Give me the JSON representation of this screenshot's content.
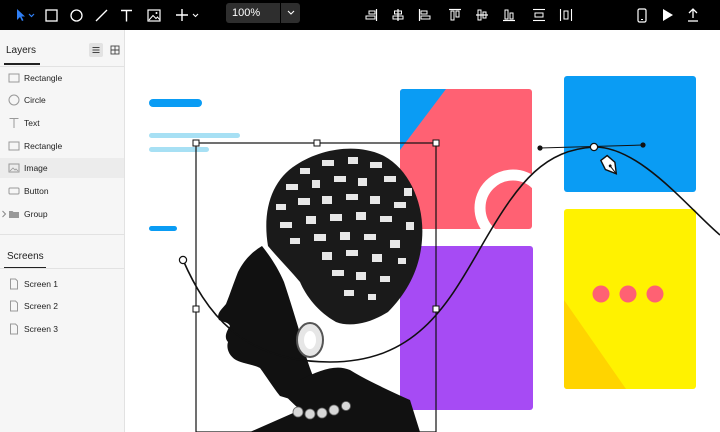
{
  "toolbar": {
    "zoom_value": "100%",
    "tools": [
      "select-tool",
      "rectangle-tool",
      "ellipse-tool",
      "line-tool",
      "text-tool",
      "image-tool",
      "add-tool"
    ],
    "align": [
      "align-top",
      "align-middle",
      "align-left",
      "align-bottom",
      "distribute-horizontal",
      "align-bottom-edge",
      "distribute-vertical",
      "align-right"
    ],
    "right": [
      "device-preview",
      "play",
      "export"
    ]
  },
  "sidebar": {
    "layers_title": "Layers",
    "layers": [
      {
        "label": "Rectangle",
        "icon": "rectangle-icon"
      },
      {
        "label": "Circle",
        "icon": "circle-icon"
      },
      {
        "label": "Text",
        "icon": "text-icon"
      },
      {
        "label": "Rectangle",
        "icon": "rectangle-icon"
      },
      {
        "label": "Image",
        "icon": "image-icon"
      },
      {
        "label": "Button",
        "icon": "button-icon"
      },
      {
        "label": "Group",
        "icon": "folder-icon"
      }
    ],
    "screens_title": "Screens",
    "screens": [
      {
        "label": "Screen 1"
      },
      {
        "label": "Screen 2"
      },
      {
        "label": "Screen 3"
      }
    ]
  },
  "canvas": {
    "colors": {
      "accent_blue": "#0a9cf4",
      "coral": "#ff6173",
      "purple": "#a64bf4",
      "yellow": "#fff200",
      "light_blue": "#a7e0f4",
      "orange_yellow": "#ffd400"
    }
  }
}
